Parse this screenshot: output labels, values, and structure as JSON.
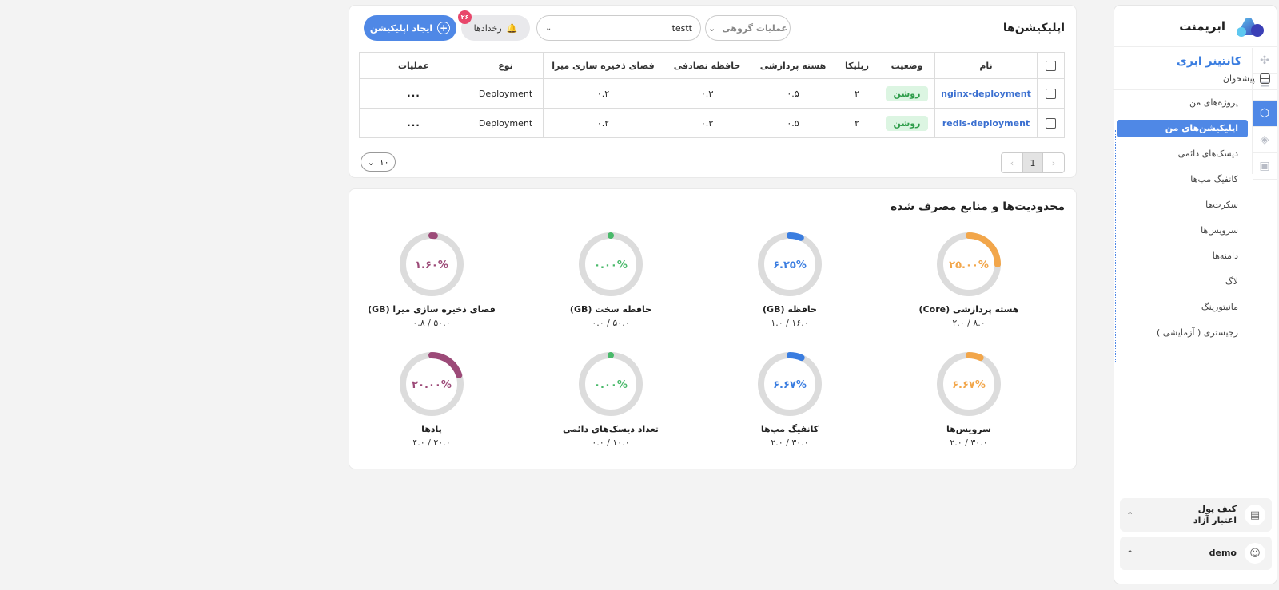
{
  "brand": {
    "name": "ابریمنت"
  },
  "sidebar": {
    "section_title": "کانتینر ابری",
    "dashboard": "پیشخوان",
    "items": [
      {
        "label": "پروژه‌های من",
        "active": false
      },
      {
        "label": "اپلیکیشن‌های من",
        "active": true
      },
      {
        "label": "دیسک‌های دائمی",
        "active": false
      },
      {
        "label": "کانفیگ مپ‌ها",
        "active": false
      },
      {
        "label": "سکرت‌ها",
        "active": false
      },
      {
        "label": "سرویس‌ها",
        "active": false
      },
      {
        "label": "دامنه‌ها",
        "active": false
      },
      {
        "label": "لاگ",
        "active": false
      },
      {
        "label": "مانیتورینگ",
        "active": false
      },
      {
        "label": "رجیستری ( آزمایشی )",
        "active": false
      }
    ],
    "wallet": {
      "line1": "کیف پول",
      "line2": "اعتبار آزاد"
    },
    "user": {
      "name": "demo"
    }
  },
  "apps": {
    "title": "اپلیکیشن‌ها",
    "create_label": "ایجاد اپلیکیشن",
    "events_label": "رخدادها",
    "events_count": "۲۶",
    "namespace_value": "testt",
    "bulk_label": "عملیات گروهی",
    "columns": [
      "نام",
      "وضعیت",
      "رپلیکا",
      "هسته پردازشی",
      "حافظه تصادفی",
      "فضای ذخیره سازی میرا",
      "نوع",
      "عملیات"
    ],
    "rows": [
      {
        "name": "nginx-deployment",
        "status": "روشن",
        "replica": "۲",
        "cpu": "۰.۵",
        "ram": "۰.۳",
        "storage": "۰.۲",
        "type": "Deployment",
        "actions": "..."
      },
      {
        "name": "redis-deployment",
        "status": "روشن",
        "replica": "۲",
        "cpu": "۰.۵",
        "ram": "۰.۳",
        "storage": "۰.۲",
        "type": "Deployment",
        "actions": "..."
      }
    ],
    "pagination": {
      "current": "1",
      "per_page": "۱۰"
    }
  },
  "resources": {
    "title": "محدودیت‌ها و منابع مصرف شده",
    "gauges": [
      {
        "label": "هسته پردازشی (Core)",
        "percent_text": "۲۵.۰۰%",
        "fraction": 0.25,
        "usage": "۲.۰ / ۸.۰",
        "color": "#f2a64a"
      },
      {
        "label": "حافظه (GB)",
        "percent_text": "۶.۲۵%",
        "fraction": 0.0625,
        "usage": "۱.۰ / ۱۶.۰",
        "color": "#3a7de0"
      },
      {
        "label": "حافظه سخت (GB)",
        "percent_text": "۰.۰۰%",
        "fraction": 0,
        "usage": "۰.۰ / ۵۰.۰",
        "color": "#49b96a"
      },
      {
        "label": "فضای ذخیره سازی میرا (GB)",
        "percent_text": "۱.۶۰%",
        "fraction": 0.016,
        "usage": "۰.۸ / ۵۰.۰",
        "color": "#9c4a78"
      },
      {
        "label": "سرویس‌ها",
        "percent_text": "۶.۶۷%",
        "fraction": 0.0667,
        "usage": "۲.۰ / ۳۰.۰",
        "color": "#f2a64a"
      },
      {
        "label": "کانفیگ مپ‌ها",
        "percent_text": "۶.۶۷%",
        "fraction": 0.0667,
        "usage": "۲.۰ / ۳۰.۰",
        "color": "#3a7de0"
      },
      {
        "label": "تعداد دیسک‌های دائمی",
        "percent_text": "۰.۰۰%",
        "fraction": 0,
        "usage": "۰.۰ / ۱۰.۰",
        "color": "#49b96a"
      },
      {
        "label": "پادها",
        "percent_text": "۲۰.۰۰%",
        "fraction": 0.2,
        "usage": "۴.۰ / ۲۰.۰",
        "color": "#9c4a78"
      }
    ]
  }
}
